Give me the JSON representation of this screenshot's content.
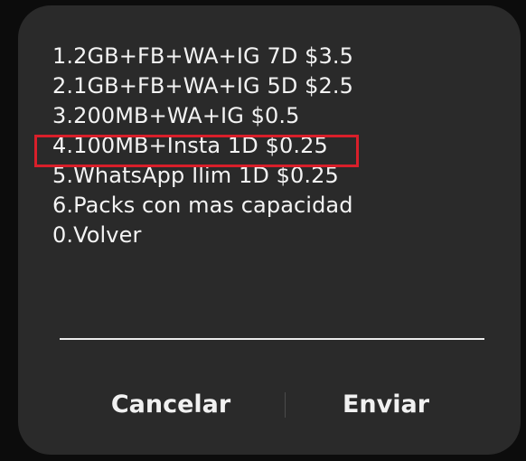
{
  "ussd_dialog": {
    "menu_items": [
      "1.2GB+FB+WA+IG 7D $3.5",
      "2.1GB+FB+WA+IG 5D $2.5",
      "3.200MB+WA+IG $0.5",
      "4.100MB+Insta 1D $0.25",
      "5.WhatsApp Ilim 1D $0.25",
      "6.Packs con mas capacidad",
      "0.Volver"
    ],
    "highlighted_index": 3,
    "highlight_color": "#d91f2a",
    "reply_value": "",
    "cancel_label": "Cancelar",
    "send_label": "Enviar"
  }
}
